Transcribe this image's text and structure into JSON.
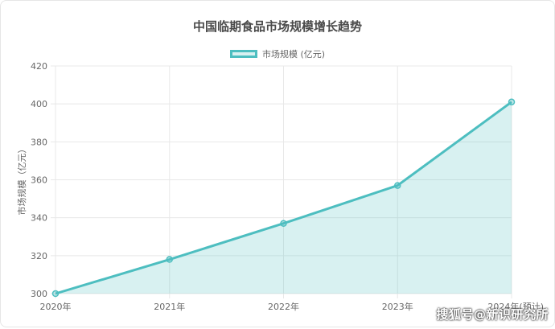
{
  "chart_data": {
    "type": "line",
    "title": "中国临期食品市场规模增长趋势",
    "ylabel": "市场规模（亿元）",
    "xlabel": "",
    "categories": [
      "2020年",
      "2021年",
      "2022年",
      "2023年",
      "2024年(预计)"
    ],
    "series": [
      {
        "name": "市场规模 (亿元)",
        "values": [
          300,
          318,
          337,
          357,
          401
        ]
      }
    ],
    "ylim": [
      300,
      420
    ],
    "yticks": [
      300,
      320,
      340,
      360,
      380,
      400,
      420
    ],
    "grid": true,
    "legend": "top-center",
    "filled": true,
    "colors": {
      "line": "#4dbec0",
      "fill": "rgba(77,190,192,0.22)",
      "grid": "#e8e8e8",
      "text": "#666666"
    }
  },
  "watermark": {
    "text": "搜狐号@新识研究所"
  }
}
